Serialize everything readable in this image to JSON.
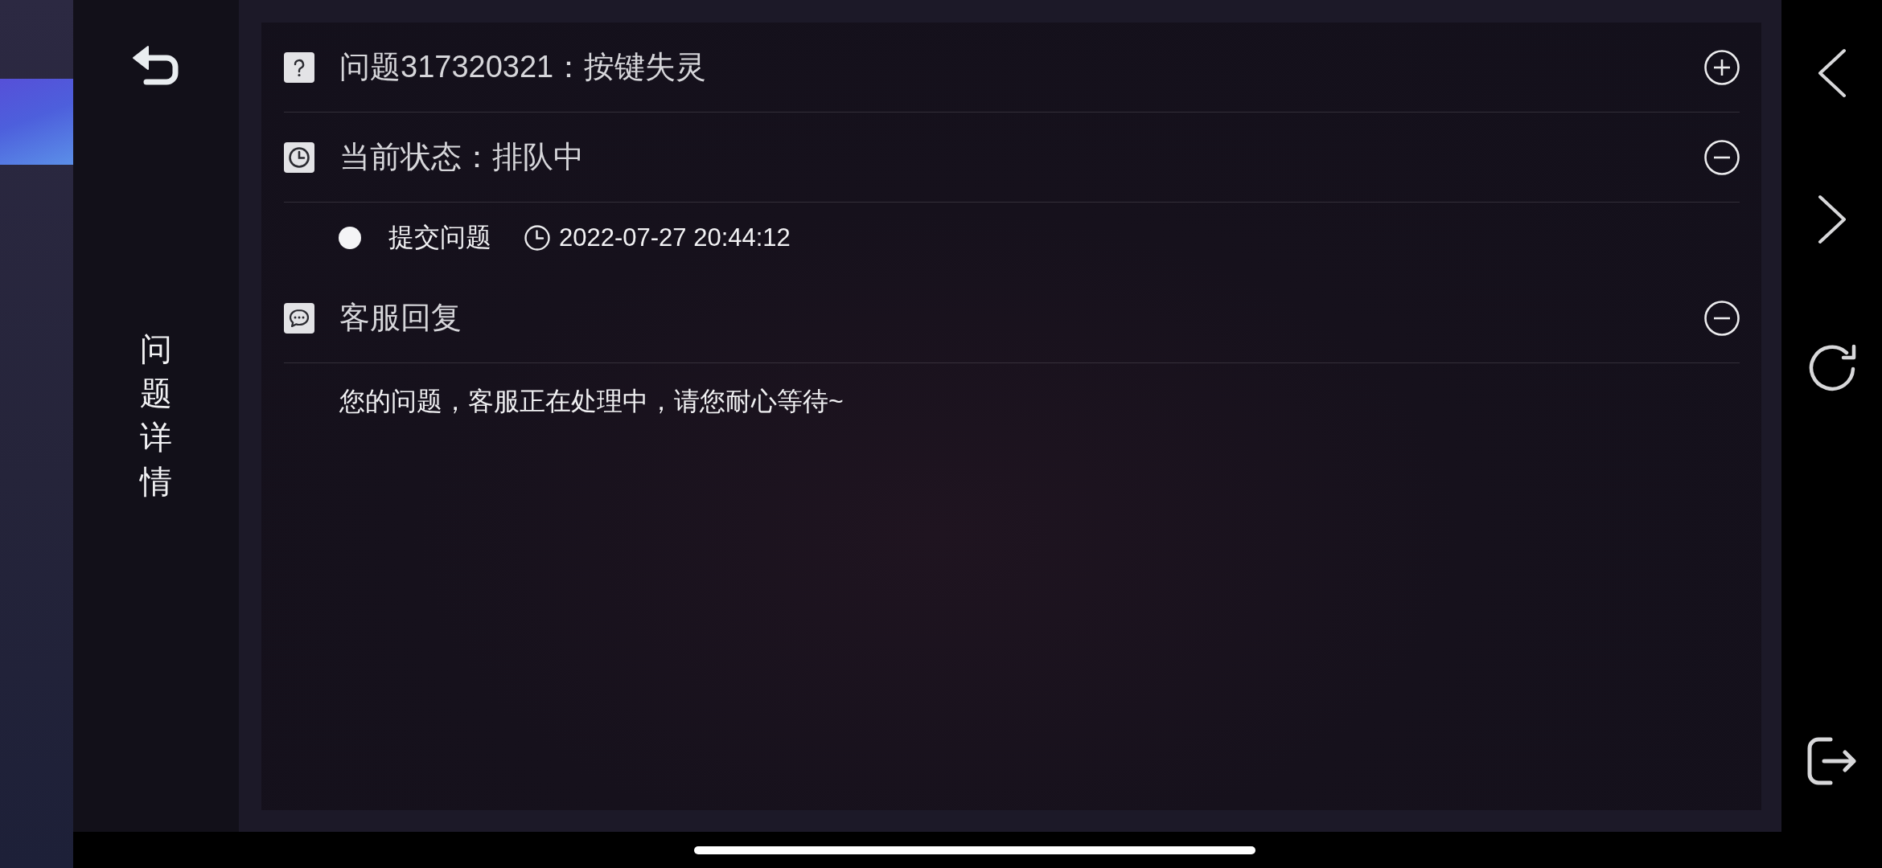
{
  "sidebar": {
    "title": "问题详情"
  },
  "sections": [
    {
      "kind": "question",
      "title": "问题317320321：按键失灵",
      "expanded": false
    },
    {
      "kind": "status",
      "title": "当前状态：排队中",
      "expanded": true,
      "events": [
        {
          "label": "提交问题",
          "time": "2022-07-27 20:44:12"
        }
      ]
    },
    {
      "kind": "reply",
      "title": "客服回复",
      "expanded": true,
      "messages": [
        "您的问题，客服正在处理中，请您耐心等待~"
      ]
    }
  ]
}
